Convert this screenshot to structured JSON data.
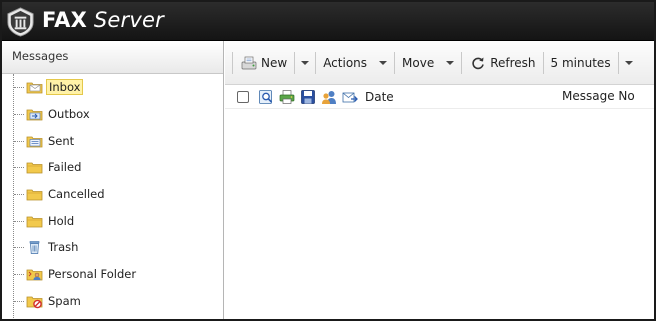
{
  "app": {
    "title_bold": "FAX",
    "title_light": "Server"
  },
  "left_panel": {
    "header": "Messages",
    "folders": [
      {
        "label": "Inbox",
        "icon": "inbox-icon",
        "selected": true
      },
      {
        "label": "Outbox",
        "icon": "outbox-icon",
        "selected": false
      },
      {
        "label": "Sent",
        "icon": "sent-icon",
        "selected": false
      },
      {
        "label": "Failed",
        "icon": "folder-icon",
        "selected": false
      },
      {
        "label": "Cancelled",
        "icon": "folder-icon",
        "selected": false
      },
      {
        "label": "Hold",
        "icon": "folder-icon",
        "selected": false
      },
      {
        "label": "Trash",
        "icon": "trash-icon",
        "selected": false
      },
      {
        "label": "Personal Folder",
        "icon": "personal-folder-icon",
        "selected": false
      },
      {
        "label": "Spam",
        "icon": "spam-icon",
        "selected": false
      }
    ]
  },
  "toolbar": {
    "new_label": "New",
    "actions_label": "Actions",
    "move_label": "Move",
    "refresh_label": "Refresh",
    "interval_label": "5 minutes"
  },
  "grid": {
    "date_header": "Date",
    "message_no_header": "Message No"
  },
  "colors": {
    "header_bg": "#1f1f1f",
    "selected_bg": "#fff2a8",
    "folder_yellow": "#f2c94c"
  }
}
